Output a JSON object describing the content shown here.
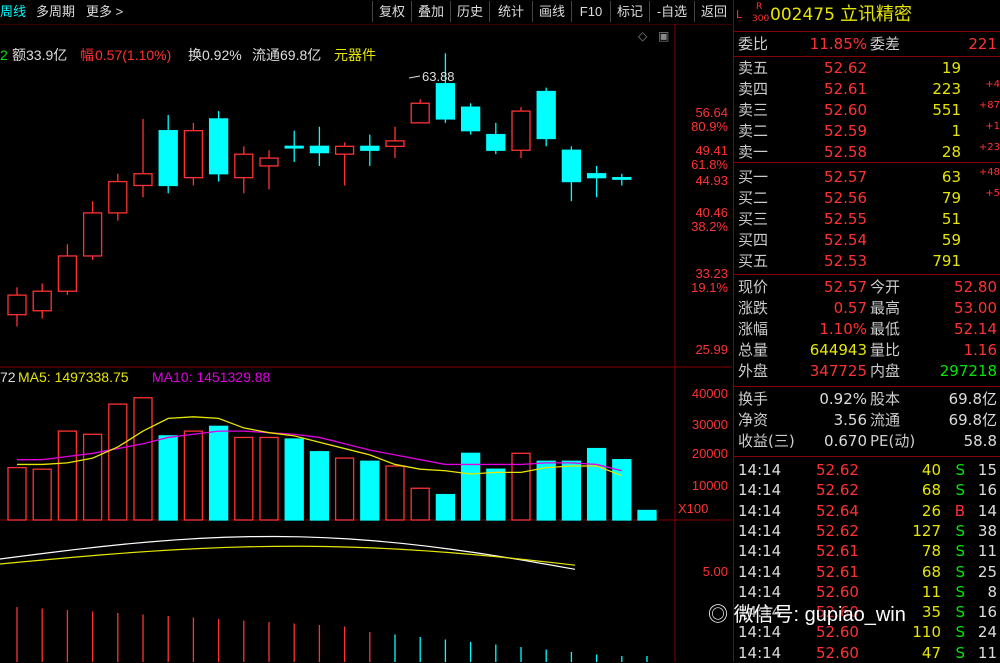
{
  "toolbar": {
    "tab_week": "周线",
    "multi_period": "多周期",
    "more": "更多",
    "buttons": [
      "复权",
      "叠加",
      "历史",
      "统计",
      "画线",
      "F10",
      "标记",
      "-自选",
      "返回"
    ]
  },
  "info_line": {
    "prefix": "2",
    "amount": "额33.9亿",
    "range_label": "幅",
    "range_value": "0.57(1.10%)",
    "turnover": "换0.92%",
    "float": "流通69.8亿",
    "sector": "元器件"
  },
  "price_axis": {
    "labels": [
      "56.64",
      "80.9%",
      "49.41",
      "61.8%",
      "44.93",
      "40.46",
      "38.2%",
      "33.23",
      "19.1%",
      "25.99"
    ]
  },
  "high_marker": "63.88",
  "volume_legend": {
    "prefix": "72",
    "ma5": "MA5: 1497338.75",
    "ma10": "MA10: 1451329.88"
  },
  "volume_axis": {
    "labels": [
      "40000",
      "30000",
      "20000",
      "10000"
    ],
    "unit": "X100"
  },
  "macd_axis": {
    "label": "5.00"
  },
  "chart_data": {
    "type": "candlestick",
    "candles": [
      {
        "o": 30.5,
        "c": 33.0,
        "h": 34.0,
        "l": 29.0
      },
      {
        "o": 31.0,
        "c": 33.5,
        "h": 34.5,
        "l": 30.0
      },
      {
        "o": 33.5,
        "c": 38.0,
        "h": 39.5,
        "l": 33.0
      },
      {
        "o": 38.0,
        "c": 43.5,
        "h": 45.0,
        "l": 37.5
      },
      {
        "o": 43.5,
        "c": 47.5,
        "h": 48.5,
        "l": 42.5
      },
      {
        "o": 47.0,
        "c": 48.5,
        "h": 55.5,
        "l": 45.5
      },
      {
        "o": 54.0,
        "c": 47.0,
        "h": 56.0,
        "l": 46.0
      },
      {
        "o": 48.0,
        "c": 54.0,
        "h": 55.0,
        "l": 47.0
      },
      {
        "o": 55.5,
        "c": 48.5,
        "h": 56.5,
        "l": 47.5
      },
      {
        "o": 48.0,
        "c": 51.0,
        "h": 52.0,
        "l": 46.0
      },
      {
        "o": 49.5,
        "c": 50.5,
        "h": 51.5,
        "l": 46.5
      },
      {
        "o": 52.0,
        "c": 51.8,
        "h": 54.0,
        "l": 50.0
      },
      {
        "o": 52.0,
        "c": 51.2,
        "h": 54.5,
        "l": 49.5
      },
      {
        "o": 51.0,
        "c": 52.0,
        "h": 52.5,
        "l": 47.0
      },
      {
        "o": 52.0,
        "c": 51.5,
        "h": 53.5,
        "l": 49.5
      },
      {
        "o": 52.0,
        "c": 52.7,
        "h": 54.5,
        "l": 50.5
      },
      {
        "o": 55.0,
        "c": 57.5,
        "h": 58.0,
        "l": 55.0
      },
      {
        "o": 60.0,
        "c": 55.5,
        "h": 63.88,
        "l": 55.0
      },
      {
        "o": 57.0,
        "c": 54.0,
        "h": 57.5,
        "l": 53.5
      },
      {
        "o": 53.5,
        "c": 51.5,
        "h": 55.0,
        "l": 51.0
      },
      {
        "o": 51.5,
        "c": 56.5,
        "h": 57.0,
        "l": 50.5
      },
      {
        "o": 59.0,
        "c": 53.0,
        "h": 59.5,
        "l": 52.0
      },
      {
        "o": 51.5,
        "c": 47.5,
        "h": 52.0,
        "l": 45.0
      },
      {
        "o": 48.5,
        "c": 48.0,
        "h": 49.5,
        "l": 45.5
      },
      {
        "o": 48.0,
        "c": 47.8,
        "h": 48.5,
        "l": 47.0
      }
    ],
    "volumes": [
      16500,
      16000,
      28000,
      27000,
      36500,
      38500,
      26500,
      28000,
      29500,
      26000,
      26000,
      25500,
      21500,
      19500,
      18500,
      17000,
      10000,
      8000,
      21000,
      16000,
      21000,
      18500,
      18500,
      22500,
      19000,
      3000
    ],
    "ma5": [
      17500,
      17500,
      18000,
      19500,
      23000,
      28000,
      32000,
      32500,
      32000,
      29000,
      27500,
      26500,
      24500,
      22500,
      20500,
      17500,
      16000,
      15500,
      14500,
      15000,
      15000,
      16500,
      17000,
      17000,
      14000
    ],
    "ma10": [
      19000,
      19000,
      20000,
      21000,
      22500,
      24000,
      26000,
      27000,
      28000,
      28000,
      27500,
      27000,
      26000,
      24000,
      22000,
      20500,
      19000,
      17500,
      17500,
      17500,
      17500,
      18000,
      18000,
      17500,
      15500
    ],
    "vol_axis_max": 40000,
    "price_axis_range": [
      25.99,
      56.64
    ]
  },
  "quote": {
    "flag_l": "L",
    "flag_r": "R",
    "flag_300": "300",
    "code": "002475",
    "name": "立讯精密",
    "weibi_label": "委比",
    "weibi_value": "11.85%",
    "weicha_label": "委差",
    "weicha_value": "221",
    "asks": [
      {
        "label": "卖五",
        "price": "52.62",
        "vol": "19",
        "chg": ""
      },
      {
        "label": "卖四",
        "price": "52.61",
        "vol": "223",
        "chg": "+4"
      },
      {
        "label": "卖三",
        "price": "52.60",
        "vol": "551",
        "chg": "+87"
      },
      {
        "label": "卖二",
        "price": "52.59",
        "vol": "1",
        "chg": "+1"
      },
      {
        "label": "卖一",
        "price": "52.58",
        "vol": "28",
        "chg": "+23"
      }
    ],
    "bids": [
      {
        "label": "买一",
        "price": "52.57",
        "vol": "63",
        "chg": "+48"
      },
      {
        "label": "买二",
        "price": "52.56",
        "vol": "79",
        "chg": "+5"
      },
      {
        "label": "买三",
        "price": "52.55",
        "vol": "51",
        "chg": ""
      },
      {
        "label": "买四",
        "price": "52.54",
        "vol": "59",
        "chg": ""
      },
      {
        "label": "买五",
        "price": "52.53",
        "vol": "791",
        "chg": ""
      }
    ],
    "stats": [
      {
        "l1": "现价",
        "v1": "52.57",
        "l2": "今开",
        "v2": "52.80"
      },
      {
        "l1": "涨跌",
        "v1": "0.57",
        "l2": "最高",
        "v2": "53.00"
      },
      {
        "l1": "涨幅",
        "v1": "1.10%",
        "l2": "最低",
        "v2": "52.14"
      },
      {
        "l1": "总量",
        "v1": "644943",
        "l2": "量比",
        "v2": "1.16"
      },
      {
        "l1": "外盘",
        "v1": "347725",
        "l2": "内盘",
        "v2": "297218"
      }
    ],
    "fund": [
      {
        "l1": "换手",
        "v1": "0.92%",
        "l2": "股本",
        "v2": "69.8亿"
      },
      {
        "l1": "净资",
        "v1": "3.56",
        "l2": "流通",
        "v2": "69.8亿"
      },
      {
        "l1": "收益(三)",
        "v1": "0.670",
        "l2": "PE(动)",
        "v2": "58.8"
      }
    ],
    "ticks": [
      {
        "time": "14:14",
        "price": "52.62",
        "vol": "40",
        "side": "S",
        "n": "15"
      },
      {
        "time": "14:14",
        "price": "52.62",
        "vol": "68",
        "side": "S",
        "n": "16"
      },
      {
        "time": "14:14",
        "price": "52.64",
        "vol": "26",
        "side": "B",
        "n": "14"
      },
      {
        "time": "14:14",
        "price": "52.62",
        "vol": "127",
        "side": "S",
        "n": "38"
      },
      {
        "time": "14:14",
        "price": "52.61",
        "vol": "78",
        "side": "S",
        "n": "11"
      },
      {
        "time": "14:14",
        "price": "52.61",
        "vol": "68",
        "side": "S",
        "n": "25"
      },
      {
        "time": "14:14",
        "price": "52.60",
        "vol": "11",
        "side": "S",
        "n": "8"
      },
      {
        "time": "14:14",
        "price": "52.60",
        "vol": "35",
        "side": "S",
        "n": "16"
      },
      {
        "time": "14:14",
        "price": "52.60",
        "vol": "110",
        "side": "S",
        "n": "24"
      },
      {
        "time": "14:14",
        "price": "52.60",
        "vol": "47",
        "side": "S",
        "n": "11"
      }
    ]
  },
  "watermark": "微信号: gupiao_win",
  "colors": {
    "up": "#ff3232",
    "down": "#00ffff",
    "ma5": "#e6e600",
    "ma10": "#e000e0",
    "dif": "#ffffff",
    "dea": "#e6e600",
    "grid": "#880000"
  }
}
